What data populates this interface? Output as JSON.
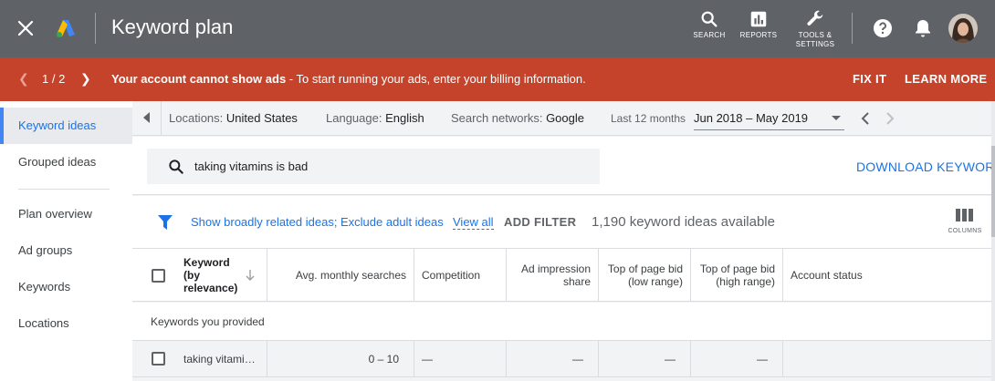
{
  "header": {
    "title": "Keyword plan",
    "tools": [
      {
        "label": "SEARCH",
        "icon": "search-icon"
      },
      {
        "label": "REPORTS",
        "icon": "reports-icon"
      },
      {
        "label_line1": "TOOLS &",
        "label_line2": "SETTINGS",
        "icon": "wrench-icon"
      }
    ],
    "bg_color": "#5f6368"
  },
  "alert": {
    "pager": "1 / 2",
    "bold": "Your account cannot show ads",
    "rest": " - To start running your ads, enter your billing information.",
    "fix_it": "FIX IT",
    "learn_more": "LEARN MORE",
    "bg_color": "#c5432b"
  },
  "sidebar": {
    "items": [
      {
        "label": "Keyword ideas",
        "active": true
      },
      {
        "label": "Grouped ideas",
        "active": false
      },
      {
        "label": "Plan overview",
        "active": false
      },
      {
        "label": "Ad groups",
        "active": false
      },
      {
        "label": "Keywords",
        "active": false
      },
      {
        "label": "Locations",
        "active": false
      }
    ]
  },
  "filters": {
    "locations_label": "Locations:",
    "locations_value": "United States",
    "language_label": "Language:",
    "language_value": "English",
    "networks_label": "Search networks:",
    "networks_value": "Google",
    "period_label": "Last 12 months",
    "date_range": "Jun 2018 – May 2019"
  },
  "search": {
    "value": "taking vitamins is bad",
    "download_label": "DOWNLOAD KEYWORD"
  },
  "toolbar": {
    "broad_link": "Show broadly related ideas;",
    "adult_link": "Exclude adult ideas",
    "view_all": "View all",
    "add_filter": "ADD FILTER",
    "count": "1,190 keyword ideas available",
    "columns_label": "COLUMNS"
  },
  "table": {
    "headers": {
      "keyword_l1": "Keyword",
      "keyword_l2": "(by",
      "keyword_l3": "relevance)",
      "avg": "Avg. monthly searches",
      "competition": "Competition",
      "impr_l1": "Ad impression",
      "impr_l2": "share",
      "low_l1": "Top of page bid",
      "low_l2": "(low range)",
      "high_l1": "Top of page bid",
      "high_l2": "(high range)",
      "status": "Account status"
    },
    "section_label": "Keywords you provided",
    "rows": [
      {
        "keyword": "taking vitami…",
        "avg": "0 – 10",
        "competition": "—",
        "impr": "—",
        "low": "—",
        "high": "—",
        "status": ""
      }
    ]
  },
  "colors": {
    "accent": "#1a73e8",
    "nav_active_bg": "#e8eaed"
  }
}
